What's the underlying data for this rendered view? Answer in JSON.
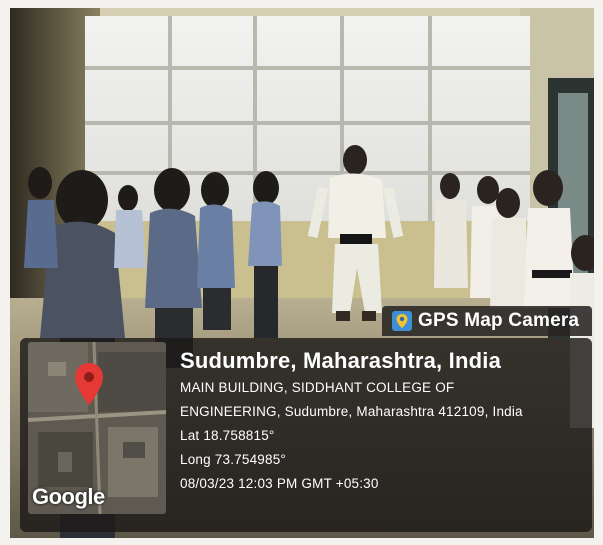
{
  "badge": {
    "label": "GPS Map Camera",
    "icon": "gps-map-camera-icon"
  },
  "map": {
    "brand": "Google",
    "pin_icon": "map-pin-icon",
    "pin_color": "#e53935"
  },
  "location": {
    "place": "Sudumbre, Maharashtra, India",
    "address_line1": "MAIN BUILDING, SIDDHANT COLLEGE OF",
    "address_line2": "ENGINEERING, Sudumbre, Maharashtra 412109, India",
    "lat": "Lat 18.758815°",
    "long": "Long 73.754985°",
    "datetime": "08/03/23 12:03 PM GMT +05:30"
  }
}
